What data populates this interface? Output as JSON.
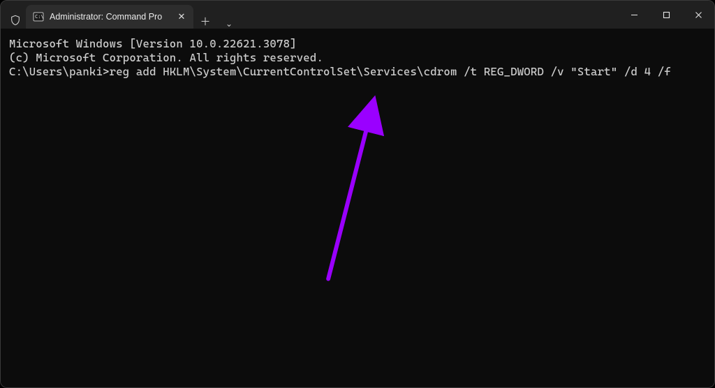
{
  "titlebar": {
    "tab_title": "Administrator: Command Pro",
    "shield_icon": "shield",
    "terminal_icon": "terminal",
    "close_glyph": "✕",
    "newtab_glyph": "＋",
    "chevron_glyph": "⌄",
    "minimize_glyph": "—",
    "maximize_glyph": "▢",
    "winclose_glyph": "✕"
  },
  "terminal": {
    "header_line1": "Microsoft Windows [Version 10.0.22621.3078]",
    "header_line2": "(c) Microsoft Corporation. All rights reserved.",
    "blank": "",
    "prompt": "C:\\Users\\panki>",
    "command": "reg add HKLM\\System\\CurrentControlSet\\Services\\cdrom /t REG_DWORD /v \"Start\" /d 4 /f"
  },
  "annotation": {
    "arrow_color": "#9a00ff"
  }
}
